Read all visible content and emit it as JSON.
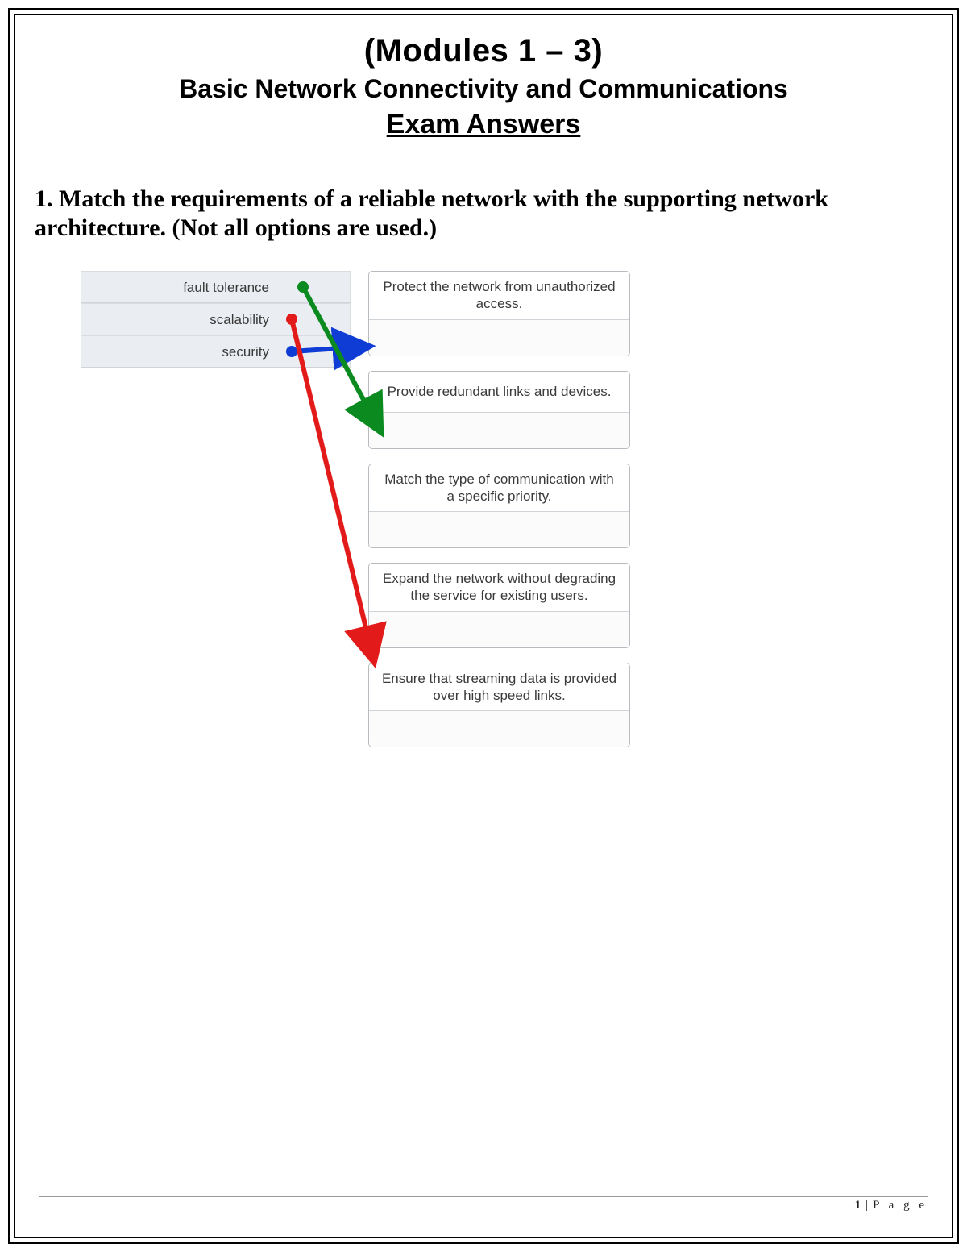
{
  "header": {
    "line1": "(Modules 1 – 3)",
    "line2": "Basic Network Connectivity and Communications",
    "line3": "Exam Answers"
  },
  "question": {
    "text": "1. Match the requirements of a reliable network with the supporting network architecture. (Not all options are used.)"
  },
  "left_items": [
    "fault tolerance",
    "scalability",
    "security"
  ],
  "right_items": [
    "Protect the network from unauthorized access.",
    "Provide redundant links and devices.",
    "Match the type of communication with a specific priority.",
    "Expand the network without degrading the service for existing users.",
    "Ensure that streaming data is provided over high speed links."
  ],
  "arrows": [
    {
      "from": "fault tolerance",
      "to_index": 1,
      "color": "#0a8a1f"
    },
    {
      "from": "scalability",
      "to_index": 3,
      "color": "#e21a1a"
    },
    {
      "from": "security",
      "to_index": 0,
      "color": "#103cd6"
    }
  ],
  "footer": {
    "page_number": "1",
    "label": "P a g e"
  }
}
